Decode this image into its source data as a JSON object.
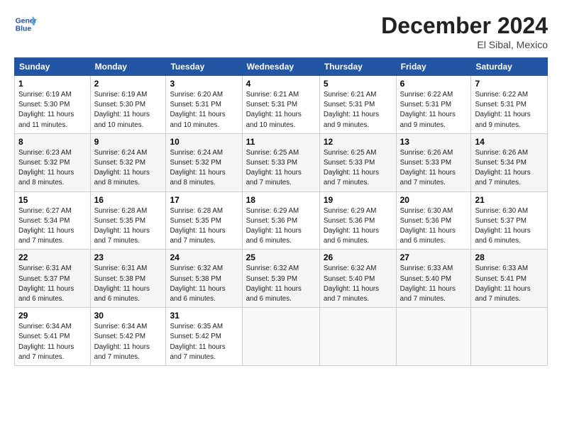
{
  "logo": {
    "line1": "General",
    "line2": "Blue"
  },
  "title": "December 2024",
  "location": "El Sibal, Mexico",
  "days_of_week": [
    "Sunday",
    "Monday",
    "Tuesday",
    "Wednesday",
    "Thursday",
    "Friday",
    "Saturday"
  ],
  "weeks": [
    [
      {
        "day": "1",
        "info": "Sunrise: 6:19 AM\nSunset: 5:30 PM\nDaylight: 11 hours\nand 11 minutes."
      },
      {
        "day": "2",
        "info": "Sunrise: 6:19 AM\nSunset: 5:30 PM\nDaylight: 11 hours\nand 10 minutes."
      },
      {
        "day": "3",
        "info": "Sunrise: 6:20 AM\nSunset: 5:31 PM\nDaylight: 11 hours\nand 10 minutes."
      },
      {
        "day": "4",
        "info": "Sunrise: 6:21 AM\nSunset: 5:31 PM\nDaylight: 11 hours\nand 10 minutes."
      },
      {
        "day": "5",
        "info": "Sunrise: 6:21 AM\nSunset: 5:31 PM\nDaylight: 11 hours\nand 9 minutes."
      },
      {
        "day": "6",
        "info": "Sunrise: 6:22 AM\nSunset: 5:31 PM\nDaylight: 11 hours\nand 9 minutes."
      },
      {
        "day": "7",
        "info": "Sunrise: 6:22 AM\nSunset: 5:31 PM\nDaylight: 11 hours\nand 9 minutes."
      }
    ],
    [
      {
        "day": "8",
        "info": "Sunrise: 6:23 AM\nSunset: 5:32 PM\nDaylight: 11 hours\nand 8 minutes."
      },
      {
        "day": "9",
        "info": "Sunrise: 6:24 AM\nSunset: 5:32 PM\nDaylight: 11 hours\nand 8 minutes."
      },
      {
        "day": "10",
        "info": "Sunrise: 6:24 AM\nSunset: 5:32 PM\nDaylight: 11 hours\nand 8 minutes."
      },
      {
        "day": "11",
        "info": "Sunrise: 6:25 AM\nSunset: 5:33 PM\nDaylight: 11 hours\nand 7 minutes."
      },
      {
        "day": "12",
        "info": "Sunrise: 6:25 AM\nSunset: 5:33 PM\nDaylight: 11 hours\nand 7 minutes."
      },
      {
        "day": "13",
        "info": "Sunrise: 6:26 AM\nSunset: 5:33 PM\nDaylight: 11 hours\nand 7 minutes."
      },
      {
        "day": "14",
        "info": "Sunrise: 6:26 AM\nSunset: 5:34 PM\nDaylight: 11 hours\nand 7 minutes."
      }
    ],
    [
      {
        "day": "15",
        "info": "Sunrise: 6:27 AM\nSunset: 5:34 PM\nDaylight: 11 hours\nand 7 minutes."
      },
      {
        "day": "16",
        "info": "Sunrise: 6:28 AM\nSunset: 5:35 PM\nDaylight: 11 hours\nand 7 minutes."
      },
      {
        "day": "17",
        "info": "Sunrise: 6:28 AM\nSunset: 5:35 PM\nDaylight: 11 hours\nand 7 minutes."
      },
      {
        "day": "18",
        "info": "Sunrise: 6:29 AM\nSunset: 5:36 PM\nDaylight: 11 hours\nand 6 minutes."
      },
      {
        "day": "19",
        "info": "Sunrise: 6:29 AM\nSunset: 5:36 PM\nDaylight: 11 hours\nand 6 minutes."
      },
      {
        "day": "20",
        "info": "Sunrise: 6:30 AM\nSunset: 5:36 PM\nDaylight: 11 hours\nand 6 minutes."
      },
      {
        "day": "21",
        "info": "Sunrise: 6:30 AM\nSunset: 5:37 PM\nDaylight: 11 hours\nand 6 minutes."
      }
    ],
    [
      {
        "day": "22",
        "info": "Sunrise: 6:31 AM\nSunset: 5:37 PM\nDaylight: 11 hours\nand 6 minutes."
      },
      {
        "day": "23",
        "info": "Sunrise: 6:31 AM\nSunset: 5:38 PM\nDaylight: 11 hours\nand 6 minutes."
      },
      {
        "day": "24",
        "info": "Sunrise: 6:32 AM\nSunset: 5:38 PM\nDaylight: 11 hours\nand 6 minutes."
      },
      {
        "day": "25",
        "info": "Sunrise: 6:32 AM\nSunset: 5:39 PM\nDaylight: 11 hours\nand 6 minutes."
      },
      {
        "day": "26",
        "info": "Sunrise: 6:32 AM\nSunset: 5:40 PM\nDaylight: 11 hours\nand 7 minutes."
      },
      {
        "day": "27",
        "info": "Sunrise: 6:33 AM\nSunset: 5:40 PM\nDaylight: 11 hours\nand 7 minutes."
      },
      {
        "day": "28",
        "info": "Sunrise: 6:33 AM\nSunset: 5:41 PM\nDaylight: 11 hours\nand 7 minutes."
      }
    ],
    [
      {
        "day": "29",
        "info": "Sunrise: 6:34 AM\nSunset: 5:41 PM\nDaylight: 11 hours\nand 7 minutes."
      },
      {
        "day": "30",
        "info": "Sunrise: 6:34 AM\nSunset: 5:42 PM\nDaylight: 11 hours\nand 7 minutes."
      },
      {
        "day": "31",
        "info": "Sunrise: 6:35 AM\nSunset: 5:42 PM\nDaylight: 11 hours\nand 7 minutes."
      },
      {
        "day": "",
        "info": ""
      },
      {
        "day": "",
        "info": ""
      },
      {
        "day": "",
        "info": ""
      },
      {
        "day": "",
        "info": ""
      }
    ]
  ]
}
